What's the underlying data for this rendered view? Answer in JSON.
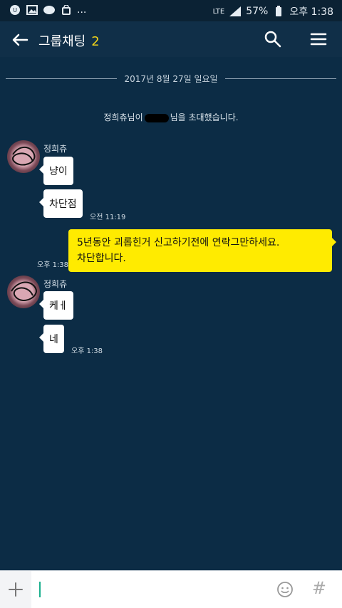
{
  "status_bar": {
    "network": "LTE",
    "battery": "57%",
    "time": "오후 1:38",
    "more": "..."
  },
  "app_bar": {
    "title": "그룹채팅",
    "member_count": "2"
  },
  "date_divider": {
    "text": "2017년 8월 27일 일요일"
  },
  "system_message": {
    "before": "정희츄님이",
    "after": "님을 초대했습니다."
  },
  "messages": [
    {
      "sender": "정희츄",
      "bubbles": [
        "냥이",
        "차단점"
      ],
      "time": "오전 11:19"
    },
    {
      "mine": true,
      "text_lines": [
        "5년동안 괴롭힌거 신고하기전에 연락그만하세요.",
        "차단합니다."
      ],
      "time": "오후 1:38"
    },
    {
      "sender": "정희츄",
      "bubbles": [
        "케ㅔ",
        "네"
      ],
      "time": "오후 1:38"
    }
  ],
  "input": {
    "placeholder": ""
  },
  "icons": [
    "back-arrow-icon",
    "search-icon",
    "menu-icon",
    "plus-icon",
    "emoji-icon",
    "hash-icon"
  ]
}
